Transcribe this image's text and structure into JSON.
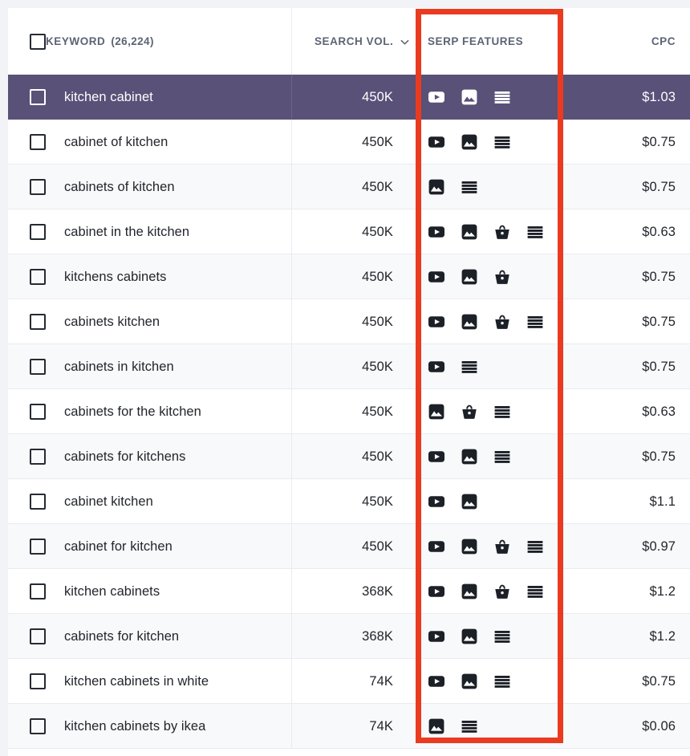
{
  "theme": {
    "selected_row_bg": "#595178",
    "annotation_color": "#ea3b21",
    "header_text_color": "#5c6474",
    "icon_color": "#1c2027",
    "row_alt_bg": "#f8f9fb",
    "page_bg": "#f2f3f7"
  },
  "annotation": {
    "label": "serp-features-column-highlight"
  },
  "table": {
    "columns": [
      {
        "key": "keyword",
        "label": "KEYWORD",
        "count": "(26,224)",
        "sortable": false,
        "has_checkbox": true
      },
      {
        "key": "volume",
        "label": "SEARCH VOL.",
        "sortable": true,
        "sort_icon": "chevron-down-icon",
        "sort_direction": "desc"
      },
      {
        "key": "serp_features",
        "label": "SERP FEATURES",
        "sortable": false
      },
      {
        "key": "cpc",
        "label": "CPC",
        "sortable": false
      }
    ],
    "feature_legend": {
      "video": "video-icon",
      "image": "image-icon",
      "shopping": "shopping-basket-icon",
      "snippet": "featured-snippet-icon"
    },
    "rows": [
      {
        "keyword": "kitchen cabinet",
        "volume": "450K",
        "features": [
          "video",
          "image",
          "snippet"
        ],
        "cpc": "$1.03",
        "selected": true
      },
      {
        "keyword": "cabinet of kitchen",
        "volume": "450K",
        "features": [
          "video",
          "image",
          "snippet"
        ],
        "cpc": "$0.75",
        "selected": false
      },
      {
        "keyword": "cabinets of kitchen",
        "volume": "450K",
        "features": [
          "image",
          "snippet"
        ],
        "cpc": "$0.75",
        "selected": false
      },
      {
        "keyword": "cabinet in the kitchen",
        "volume": "450K",
        "features": [
          "video",
          "image",
          "shopping",
          "snippet"
        ],
        "cpc": "$0.63",
        "selected": false
      },
      {
        "keyword": "kitchens cabinets",
        "volume": "450K",
        "features": [
          "video",
          "image",
          "shopping"
        ],
        "cpc": "$0.75",
        "selected": false
      },
      {
        "keyword": "cabinets kitchen",
        "volume": "450K",
        "features": [
          "video",
          "image",
          "shopping",
          "snippet"
        ],
        "cpc": "$0.75",
        "selected": false
      },
      {
        "keyword": "cabinets in kitchen",
        "volume": "450K",
        "features": [
          "video",
          "snippet"
        ],
        "cpc": "$0.75",
        "selected": false
      },
      {
        "keyword": "cabinets for the kitchen",
        "volume": "450K",
        "features": [
          "image",
          "shopping",
          "snippet"
        ],
        "cpc": "$0.63",
        "selected": false
      },
      {
        "keyword": "cabinets for kitchens",
        "volume": "450K",
        "features": [
          "video",
          "image",
          "snippet"
        ],
        "cpc": "$0.75",
        "selected": false
      },
      {
        "keyword": "cabinet kitchen",
        "volume": "450K",
        "features": [
          "video",
          "image"
        ],
        "cpc": "$1.1",
        "selected": false
      },
      {
        "keyword": "cabinet for kitchen",
        "volume": "450K",
        "features": [
          "video",
          "image",
          "shopping",
          "snippet"
        ],
        "cpc": "$0.97",
        "selected": false
      },
      {
        "keyword": "kitchen cabinets",
        "volume": "368K",
        "features": [
          "video",
          "image",
          "shopping",
          "snippet"
        ],
        "cpc": "$1.2",
        "selected": false
      },
      {
        "keyword": "cabinets for kitchen",
        "volume": "368K",
        "features": [
          "video",
          "image",
          "snippet"
        ],
        "cpc": "$1.2",
        "selected": false
      },
      {
        "keyword": "kitchen cabinets in white",
        "volume": "74K",
        "features": [
          "video",
          "image",
          "snippet"
        ],
        "cpc": "$0.75",
        "selected": false
      },
      {
        "keyword": "kitchen cabinets by ikea",
        "volume": "74K",
        "features": [
          "image",
          "snippet"
        ],
        "cpc": "$0.06",
        "selected": false
      }
    ]
  }
}
